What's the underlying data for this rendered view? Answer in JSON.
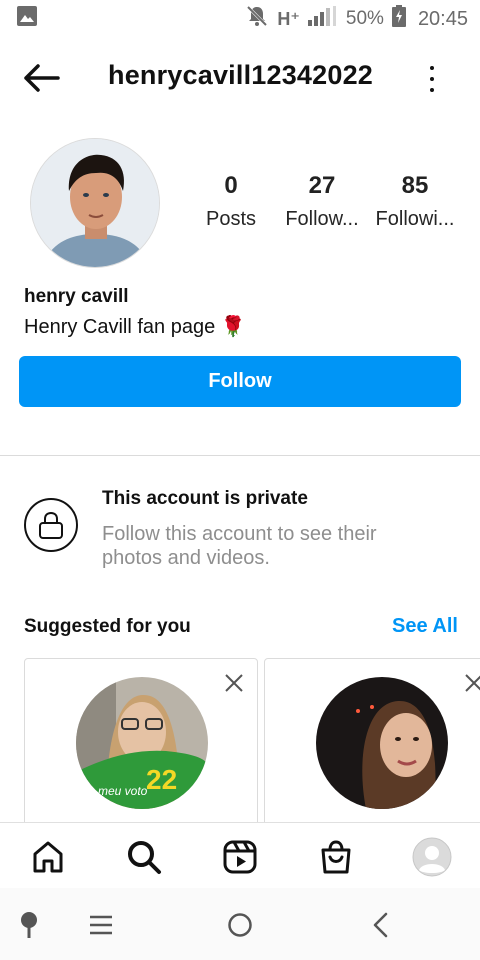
{
  "status_bar": {
    "icons": [
      "image-icon",
      "mute-icon",
      "hplus-network-icon",
      "signal-icon",
      "battery-charging-icon"
    ],
    "network": "H⁺",
    "battery": "50%",
    "time": "20:45"
  },
  "header": {
    "username": "henrycavill12342022",
    "back_icon": "back-arrow-icon",
    "more_icon": "more-vertical-icon"
  },
  "profile": {
    "stats": [
      {
        "value": "0",
        "label": "Posts"
      },
      {
        "value": "27",
        "label": "Follow..."
      },
      {
        "value": "85",
        "label": "Followi..."
      }
    ],
    "display_name": "henry cavill",
    "bio": "Henry Cavill fan page 🌹"
  },
  "follow_button": {
    "label": "Follow"
  },
  "private": {
    "icon": "lock-icon",
    "title": "This account is private",
    "description": "Follow this account to see their photos and videos."
  },
  "suggested": {
    "title": "Suggested for you",
    "see_all": "See All",
    "cards": [
      {
        "avatar_badge_text": "meu voto 22"
      },
      {}
    ]
  },
  "bottom_nav": {
    "items": [
      "home-icon",
      "search-icon",
      "reels-icon",
      "shop-icon",
      "profile-avatar-icon"
    ]
  },
  "system_nav": {
    "items": [
      "assistant-icon",
      "recents-icon",
      "home-circle-icon",
      "back-icon"
    ]
  },
  "colors": {
    "accent": "#0095f6",
    "text": "#262626",
    "muted": "#8e8e8e",
    "divider": "#dbdbdb"
  }
}
